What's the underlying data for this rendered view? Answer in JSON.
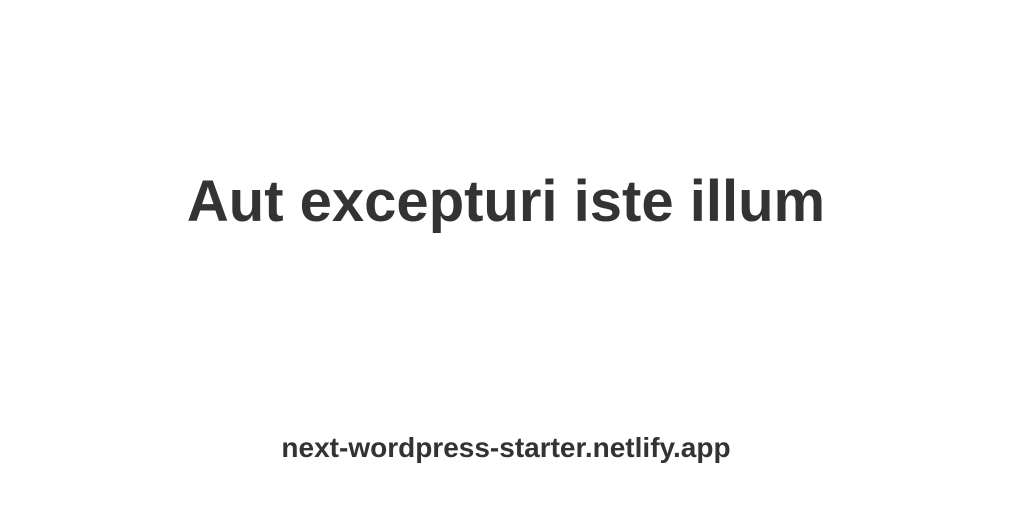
{
  "card": {
    "title": "Aut excepturi iste illum",
    "site_url": "next-wordpress-starter.netlify.app"
  },
  "colors": {
    "background": "#ffffff",
    "text": "#333333"
  }
}
